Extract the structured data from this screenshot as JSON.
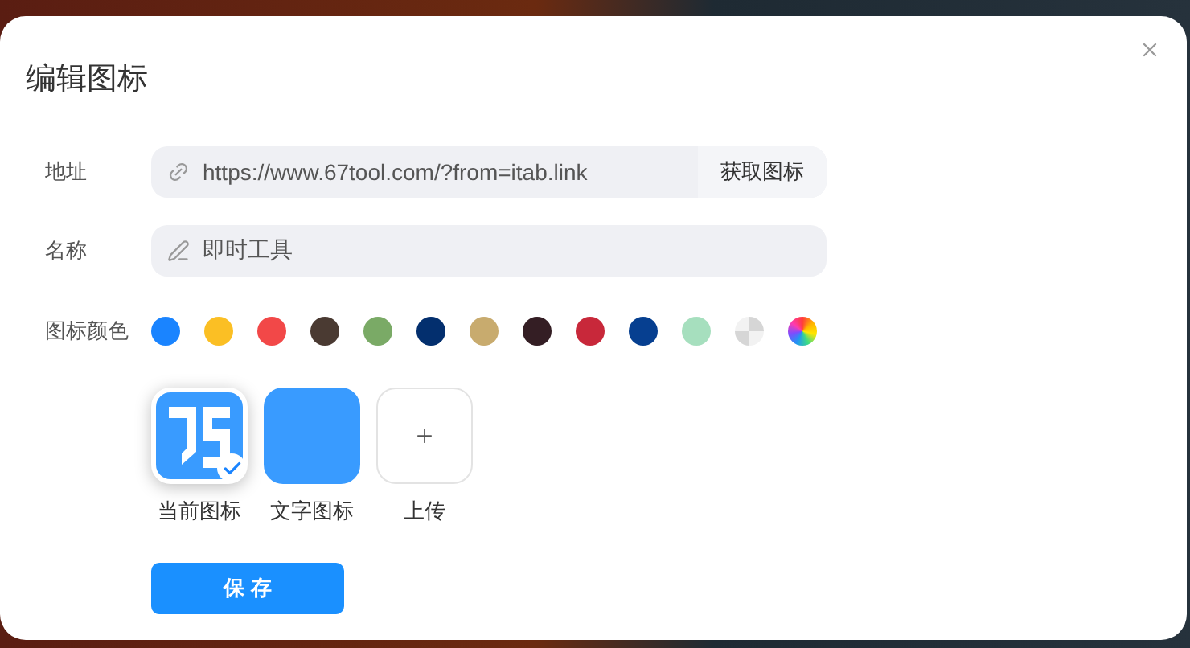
{
  "dialog": {
    "title": "编辑图标"
  },
  "address": {
    "label": "地址",
    "value": "https://www.67tool.com/?from=itab.link",
    "button": "获取图标"
  },
  "name": {
    "label": "名称",
    "value": "即时工具"
  },
  "icon_color": {
    "label": "图标颜色",
    "swatches": [
      {
        "kind": "solid",
        "color": "#1a84ff"
      },
      {
        "kind": "solid",
        "color": "#fbbf24"
      },
      {
        "kind": "solid",
        "color": "#f24848"
      },
      {
        "kind": "solid",
        "color": "#4a3a32"
      },
      {
        "kind": "solid",
        "color": "#7aaa66"
      },
      {
        "kind": "solid",
        "color": "#032f6e"
      },
      {
        "kind": "solid",
        "color": "#c8ab6e"
      },
      {
        "kind": "solid",
        "color": "#341e24"
      },
      {
        "kind": "solid",
        "color": "#c8283a"
      },
      {
        "kind": "solid",
        "color": "#063f90"
      },
      {
        "kind": "solid",
        "color": "#a6dfbe"
      },
      {
        "kind": "transparent"
      },
      {
        "kind": "custom"
      }
    ]
  },
  "icon_options": [
    {
      "kind": "image",
      "label": "当前图标",
      "selected": true
    },
    {
      "kind": "text",
      "label": "文字图标",
      "selected": false
    },
    {
      "kind": "upload",
      "label": "上传",
      "selected": false
    }
  ],
  "save_button": "保 存"
}
